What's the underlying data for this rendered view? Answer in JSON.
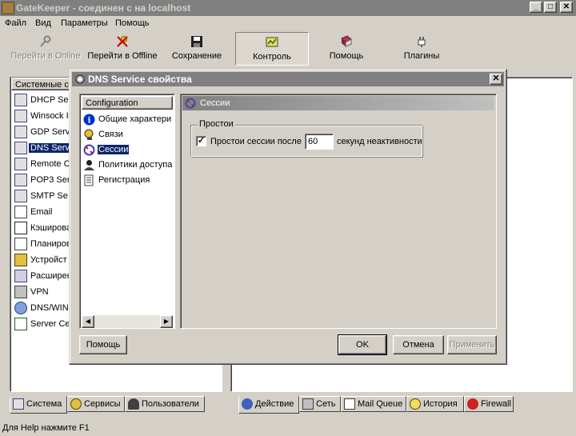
{
  "window": {
    "title": "GateKeeper - соединен с на localhost"
  },
  "menu": [
    "Файл",
    "Вид",
    "Параметры",
    "Помощь"
  ],
  "toolbar": {
    "go_online": "Перейти в Online",
    "go_offline": "Перейти в Offline",
    "save": "Сохранение",
    "control": "Контроль",
    "help": "Помощь",
    "plugins": "Плагины"
  },
  "left_panel": {
    "header": "Системные с",
    "items": [
      "DHCP Se",
      "Winsock I",
      "GDP Serv",
      "DNS Servi",
      "Remote C",
      "POP3 Ser",
      "SMTP Se",
      "Email",
      "Кэширова",
      "Планиров",
      "Устройст",
      "Расширен",
      "VPN",
      "DNS/WIN",
      "Server Ce"
    ],
    "tabs": [
      "Система",
      "Сервисы",
      "Пользователи"
    ]
  },
  "right_panel": {
    "tabs": [
      "Действие",
      "Сеть",
      "Mail Queue",
      "История",
      "Firewall"
    ]
  },
  "status": "Для Help нажмите F1",
  "dialog": {
    "title": "DNS Service свойства",
    "close": "✕",
    "config_header": "Configuration",
    "config_items": [
      "Общие характери",
      "Связи",
      "Сессии",
      "Политики доступа",
      "Регистрация"
    ],
    "pane_title": "Сессии",
    "group_title": "Простои",
    "idle_label": "Простои сессии после",
    "idle_value": "60",
    "idle_suffix": "секунд неактивности",
    "buttons": {
      "help": "Помощь",
      "ok": "OK",
      "cancel": "Отмена",
      "apply": "Применить"
    }
  }
}
